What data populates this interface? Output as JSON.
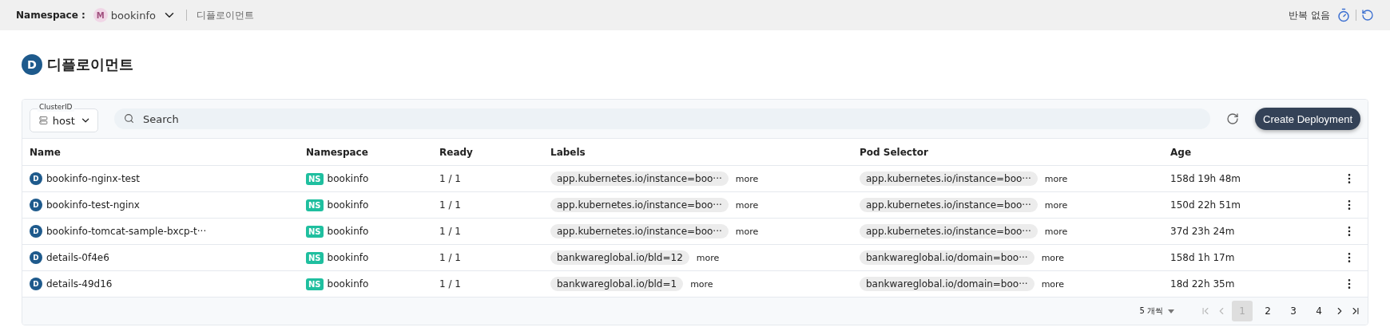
{
  "topbar": {
    "namespace_label": "Namespace :",
    "namespace_avatar": "M",
    "namespace": "bookinfo",
    "breadcrumb": "디플로이먼트",
    "repeat": "반복 없음"
  },
  "page": {
    "badge": "D",
    "title": "디플로이먼트"
  },
  "toolbar": {
    "cluster_label": "ClusterID",
    "cluster": "host",
    "search_placeholder": "Search",
    "create_button": "Create Deployment"
  },
  "table": {
    "columns": [
      "Name",
      "Namespace",
      "Ready",
      "Labels",
      "Pod Selector",
      "Age"
    ],
    "rows": [
      {
        "badge": "D",
        "name": "bookinfo-nginx-test",
        "ns_badge": "NS",
        "namespace": "bookinfo",
        "ready": "1 / 1",
        "label": "app.kubernetes.io/instance=boo···",
        "label_more": "more",
        "selector": "app.kubernetes.io/instance=boo···",
        "selector_more": "more",
        "age": "158d 19h 48m"
      },
      {
        "badge": "D",
        "name": "bookinfo-test-nginx",
        "ns_badge": "NS",
        "namespace": "bookinfo",
        "ready": "1 / 1",
        "label": "app.kubernetes.io/instance=boo···",
        "label_more": "more",
        "selector": "app.kubernetes.io/instance=boo···",
        "selector_more": "more",
        "age": "150d 22h 51m"
      },
      {
        "badge": "D",
        "name": "bookinfo-tomcat-sample-bxcp-t···",
        "ns_badge": "NS",
        "namespace": "bookinfo",
        "ready": "1 / 1",
        "label": "app.kubernetes.io/instance=boo···",
        "label_more": "more",
        "selector": "app.kubernetes.io/instance=boo···",
        "selector_more": "more",
        "age": "37d 23h 24m"
      },
      {
        "badge": "D",
        "name": "details-0f4e6",
        "ns_badge": "NS",
        "namespace": "bookinfo",
        "ready": "1 / 1",
        "label": "bankwareglobal.io/bld=12",
        "label_more": "more",
        "selector": "bankwareglobal.io/domain=boo···",
        "selector_more": "more",
        "age": "158d 1h 17m"
      },
      {
        "badge": "D",
        "name": "details-49d16",
        "ns_badge": "NS",
        "namespace": "bookinfo",
        "ready": "1 / 1",
        "label": "bankwareglobal.io/bld=1",
        "label_more": "more",
        "selector": "bankwareglobal.io/domain=boo···",
        "selector_more": "more",
        "age": "18d 22h 35m"
      }
    ]
  },
  "pagination": {
    "page_size": "5 개씩",
    "first_disabled": true,
    "prev_disabled": true,
    "pages": [
      {
        "label": "1",
        "selected": true
      },
      {
        "label": "2",
        "selected": false
      },
      {
        "label": "3",
        "selected": false
      },
      {
        "label": "4",
        "selected": false
      }
    ],
    "next_disabled": false,
    "last_disabled": false
  }
}
